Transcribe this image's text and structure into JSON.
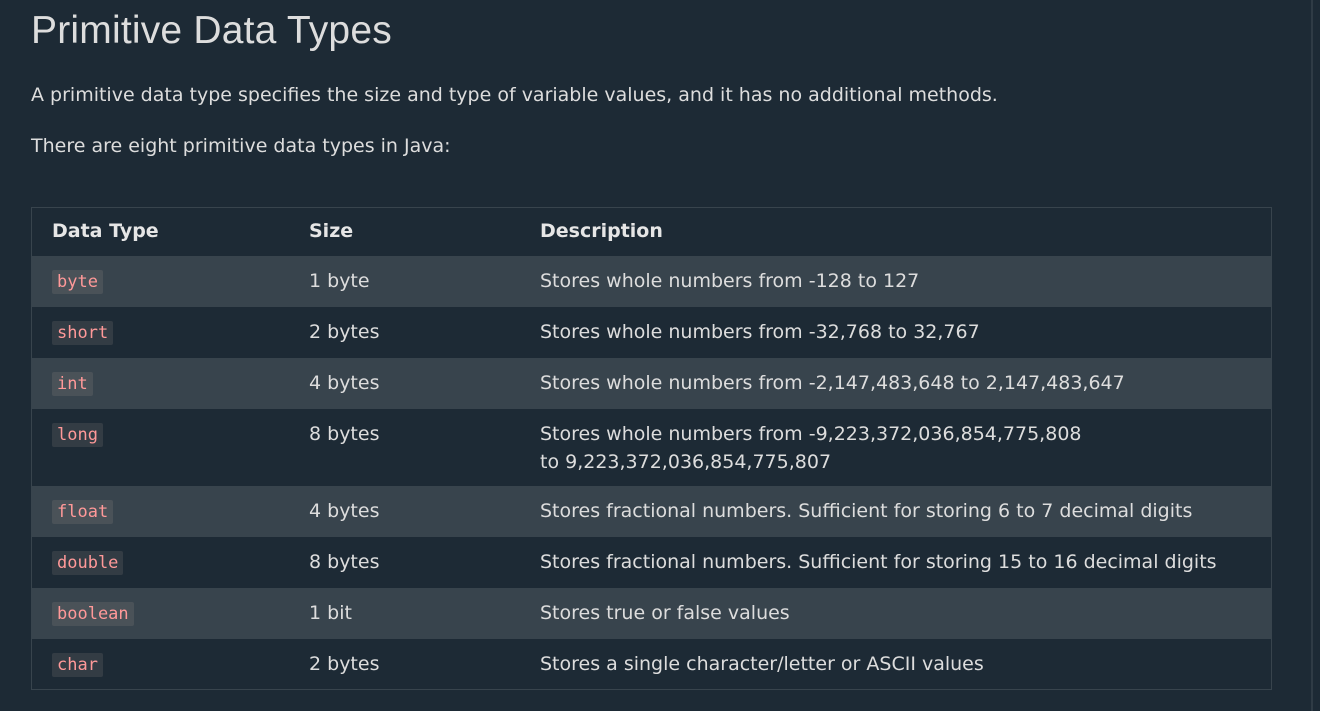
{
  "heading": "Primitive Data Types",
  "paragraphs": [
    "A primitive data type specifies the size and type of variable values, and it has no additional methods.",
    "There are eight primitive data types in Java:"
  ],
  "table": {
    "headers": [
      "Data Type",
      "Size",
      "Description"
    ],
    "rows": [
      {
        "type": "byte",
        "size": "1 byte",
        "description": "Stores whole numbers from -128 to 127"
      },
      {
        "type": "short",
        "size": "2 bytes",
        "description": "Stores whole numbers from -32,768 to 32,767"
      },
      {
        "type": "int",
        "size": "4 bytes",
        "description": "Stores whole numbers from -2,147,483,648 to 2,147,483,647"
      },
      {
        "type": "long",
        "size": "8 bytes",
        "description": "Stores whole numbers from -9,223,372,036,854,775,808 to 9,223,372,036,854,775,807"
      },
      {
        "type": "float",
        "size": "4 bytes",
        "description": "Stores fractional numbers. Sufficient for storing 6 to 7 decimal digits"
      },
      {
        "type": "double",
        "size": "8 bytes",
        "description": "Stores fractional numbers. Sufficient for storing 15 to 16 decimal digits"
      },
      {
        "type": "boolean",
        "size": "1 bit",
        "description": "Stores true or false values"
      },
      {
        "type": "char",
        "size": "2 bytes",
        "description": "Stores a single character/letter or ASCII values"
      }
    ]
  },
  "colors": {
    "background": "#1d2a35",
    "row_alt": "#38444d",
    "text": "#dddddd",
    "code_text": "#ff9999"
  }
}
